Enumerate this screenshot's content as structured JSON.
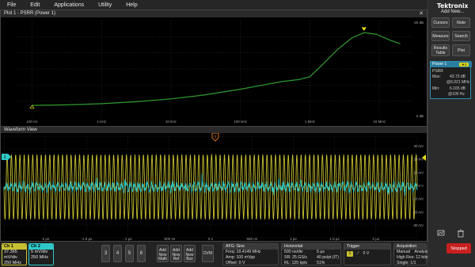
{
  "menu": {
    "items": [
      "File",
      "Edit",
      "Applications",
      "Utility",
      "Help"
    ]
  },
  "brand": "Tektronix",
  "right_panel": {
    "add_new": "Add New...",
    "buttons": {
      "cursors": "Cursors",
      "note": "Note",
      "measure": "Measure",
      "search": "Search",
      "results_table": "Results Table",
      "plot": "Plot"
    },
    "stopped": "Stopped"
  },
  "measurement": {
    "title": "Power 1",
    "badge": "▼3",
    "name": "PSRR",
    "max_label": "Max:",
    "max_value": "43.73 dB",
    "max_freq": "@6.021 MHz",
    "min_label": "Min:",
    "min_value": "6.165 dB",
    "min_freq": "@100 Hz"
  },
  "plot": {
    "title": "Plot 1 - PSRR (Power 1)",
    "close": "✕",
    "ytick_top": "50 dB",
    "ytick_bottom": "0 dB",
    "xticks": [
      "100 Hz",
      "1 kHz",
      "10 kHz",
      "100 kHz",
      "1 MHz",
      "10 MHz"
    ],
    "colors": {
      "trace": "#2e9b2e",
      "marker": "#e8e020"
    }
  },
  "chart_data": {
    "type": "line",
    "title": "",
    "xlabel": "",
    "ylabel": "",
    "x_scale": "log",
    "xlim_hz": [
      60,
      30000000
    ],
    "ylim_db": [
      0,
      50
    ],
    "series": [
      {
        "x_hz": [
          100,
          300,
          1000,
          3000,
          10000,
          30000,
          100000,
          200000,
          400000,
          700000,
          1000000,
          1500000,
          2500000,
          4000000,
          6021000,
          9000000,
          14000000,
          20000000
        ],
        "y_db": [
          6.165,
          6.4,
          7.0,
          8.0,
          9.5,
          11.5,
          14.5,
          16.5,
          18.5,
          19.5,
          21.0,
          27.0,
          35.0,
          41.0,
          43.73,
          43.0,
          40.0,
          38.0
        ]
      }
    ],
    "markers": [
      {
        "label": "min",
        "x_hz": 100,
        "y_db": 6.165
      },
      {
        "label": "max",
        "x_hz": 6021000,
        "y_db": 43.73
      }
    ]
  },
  "waveform": {
    "title": "Waveform View",
    "right_labels": [
      "30 mV",
      "20 mV",
      "10 mV",
      "0 V",
      "-10 mV",
      "-20 mV",
      "-30 mV"
    ],
    "xticks": [
      "-2 µs",
      "-1.5 µs",
      "-1 µs",
      "-500 ns",
      "0 s",
      "500 ns",
      "1 µs",
      "1.5 µs",
      "2 µs"
    ],
    "colors": {
      "ch1": "#c8c030",
      "ch2": "#2ec8c8",
      "trigger": "#f08020"
    }
  },
  "bottom": {
    "ch1": {
      "label": "Ch 1",
      "scale": "37.365 mV/div",
      "bw": "250 MHz"
    },
    "ch2": {
      "label": "Ch 2",
      "scale": "5 mV/div",
      "bw": "250 MHz"
    },
    "channels": [
      "3",
      "4",
      "5",
      "6"
    ],
    "add": {
      "math": "Add New Math",
      "ref": "Add New Ref",
      "bus": "Add New Bus",
      "dvm": "DVM"
    },
    "afg": {
      "title": "AFG: Sine",
      "freq": "Freq: 19.4149 MHz",
      "amp": "Amp: 100 mVpp",
      "offset": "Offset: 0 V"
    },
    "horizontal": {
      "title": "Horizontal",
      "scale": "500 ns/div",
      "pos": "5 µs",
      "sr": "SR: 25 GS/s",
      "pts": "40 ps/pt (IT)",
      "rl": "RL: 125 kpts",
      "pct": "51%"
    },
    "trigger": {
      "title": "Trigger",
      "ch": "1",
      "level": "0 V"
    },
    "acquisition": {
      "title": "Acquisition",
      "mode": "Manual",
      "analyze": "Analyze",
      "res": "High Res: 12 bits",
      "single": "Single: 1/1"
    }
  }
}
